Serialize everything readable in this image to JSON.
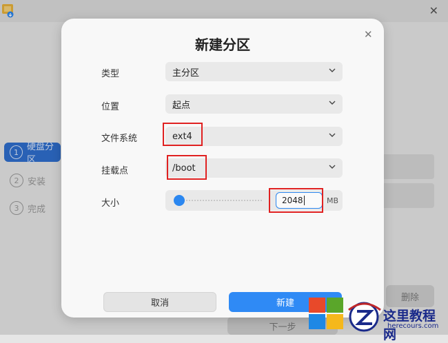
{
  "background": {
    "sidebar": [
      {
        "num": "1",
        "label": "硬盘分区",
        "active": true
      },
      {
        "num": "2",
        "label": "安装",
        "active": false
      },
      {
        "num": "3",
        "label": "完成",
        "active": false
      }
    ],
    "delete_label": "删除",
    "next_label": "下一步",
    "close_symbol": "✕"
  },
  "dialog": {
    "title": "新建分区",
    "close_symbol": "✕",
    "fields": {
      "type": {
        "label": "类型",
        "value": "主分区"
      },
      "position": {
        "label": "位置",
        "value": "起点"
      },
      "filesystem": {
        "label": "文件系统",
        "value": "ext4"
      },
      "mountpoint": {
        "label": "挂载点",
        "value": "/boot"
      },
      "size": {
        "label": "大小",
        "value": "2048",
        "unit": "MB",
        "slider_fraction": 0.0
      }
    },
    "cancel_label": "取消",
    "create_label": "新建"
  },
  "watermark": {
    "title": "这里教程网",
    "url": "herecours.com"
  },
  "colors": {
    "accent": "#2f8af5",
    "highlight": "#e02020",
    "sidebar_active": "#2f6fcf"
  }
}
